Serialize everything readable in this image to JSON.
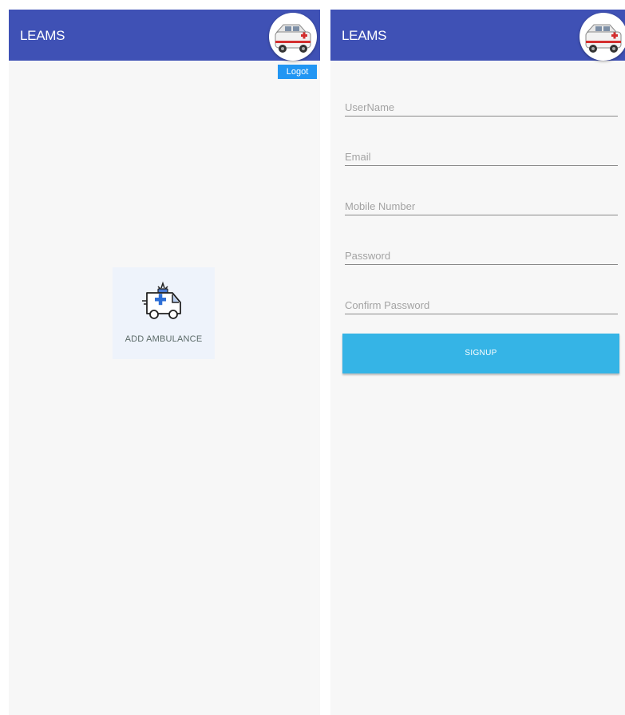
{
  "left_screen": {
    "appbar": {
      "title": "LEAMS",
      "logo_icon": "ambulance-logo-icon"
    },
    "logout_label": "Logot",
    "add_ambulance": {
      "icon": "ambulance-icon",
      "label": "ADD AMBULANCE"
    }
  },
  "right_screen": {
    "appbar": {
      "title": "LEAMS",
      "logo_icon": "ambulance-logo-icon"
    },
    "form": {
      "username_placeholder": "UserName",
      "email_placeholder": "Email",
      "mobile_placeholder": "Mobile Number",
      "password_placeholder": "Password",
      "confirm_password_placeholder": "Confirm Password",
      "signup_label": "SIGNUP"
    }
  },
  "colors": {
    "appbar": "#3f51b5",
    "logout_button": "#2196f3",
    "signup_button": "#35b4e6",
    "background": "#f7f7f7"
  }
}
